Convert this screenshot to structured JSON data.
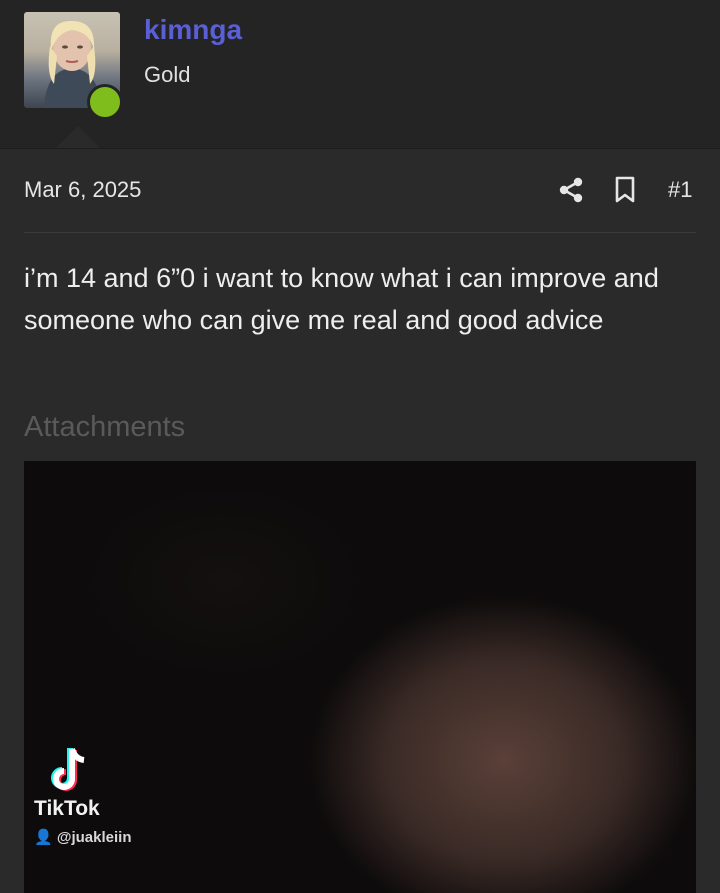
{
  "user": {
    "name": "kimnga",
    "title": "Gold",
    "name_color": "#5a5fd6",
    "online_color": "#7fbd1c"
  },
  "post": {
    "date": "Mar 6, 2025",
    "number": "#1",
    "body": "i’m 14 and 6”0 i want to know what i can improve and someone who can give me real and good advice",
    "actions": [
      "share-icon",
      "bookmark-icon"
    ]
  },
  "attachments": {
    "label": "Attachments",
    "watermark": {
      "brand": "TikTok",
      "handle": "👤 @juakleiin"
    }
  }
}
